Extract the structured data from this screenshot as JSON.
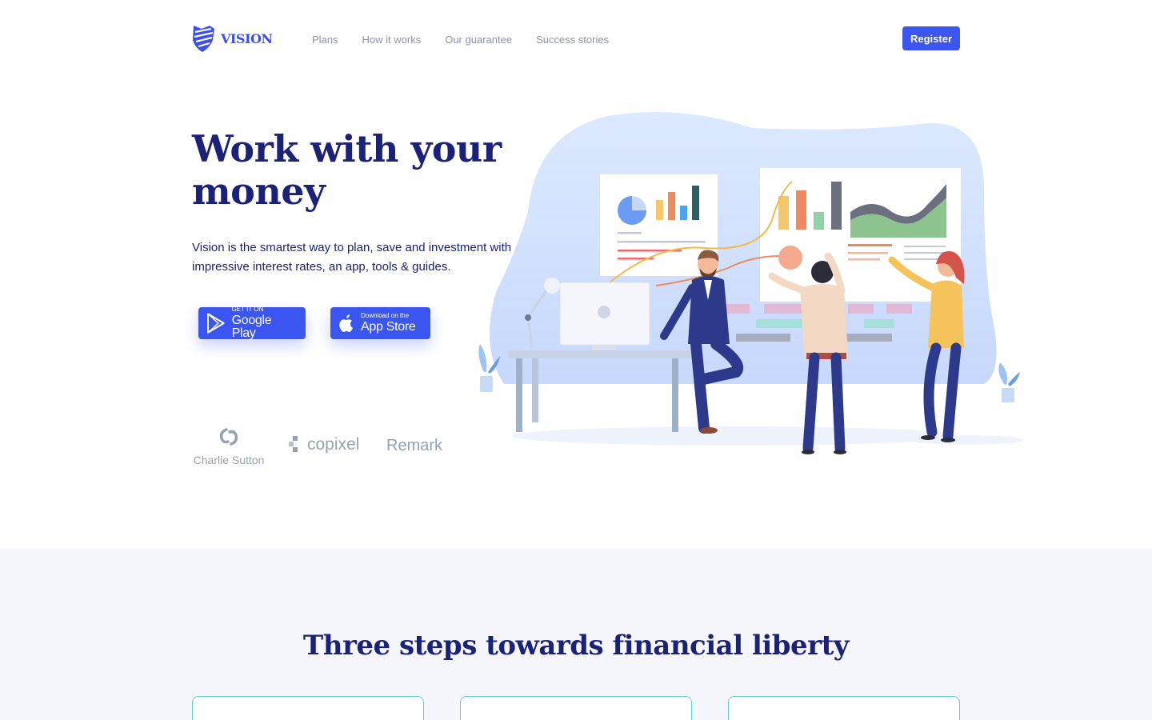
{
  "brand": {
    "name": "VISION",
    "logo_icon": "shield-stripes-icon",
    "accent_color": "#3b55f0",
    "heading_color": "#1c2178"
  },
  "nav": {
    "items": [
      {
        "label": "Plans"
      },
      {
        "label": "How it works"
      },
      {
        "label": "Our guarantee"
      },
      {
        "label": "Success stories"
      }
    ],
    "register_label": "Register"
  },
  "hero": {
    "title": "Work with your money",
    "description": "Vision is the smartest way to plan, save and investment with impressive interest rates, an app, tools & guides.",
    "google_play": {
      "small": "GET IT ON",
      "big": "Google Play",
      "icon": "google-play-icon"
    },
    "app_store": {
      "small": "Download on the",
      "big": "App Store",
      "icon": "apple-icon"
    },
    "illustration": "team-analyzing-charts-illustration"
  },
  "partners": [
    {
      "name": "Charlie Sutton",
      "icon": "charlie-sutton-logo-icon"
    },
    {
      "name": "copixel",
      "icon": "copixel-logo-icon"
    },
    {
      "name": "Remark"
    }
  ],
  "steps_section": {
    "title": "Three steps towards financial liberty",
    "background": "#f5f6fc",
    "card_border_color": "#5fd3c4",
    "cards": 3
  }
}
